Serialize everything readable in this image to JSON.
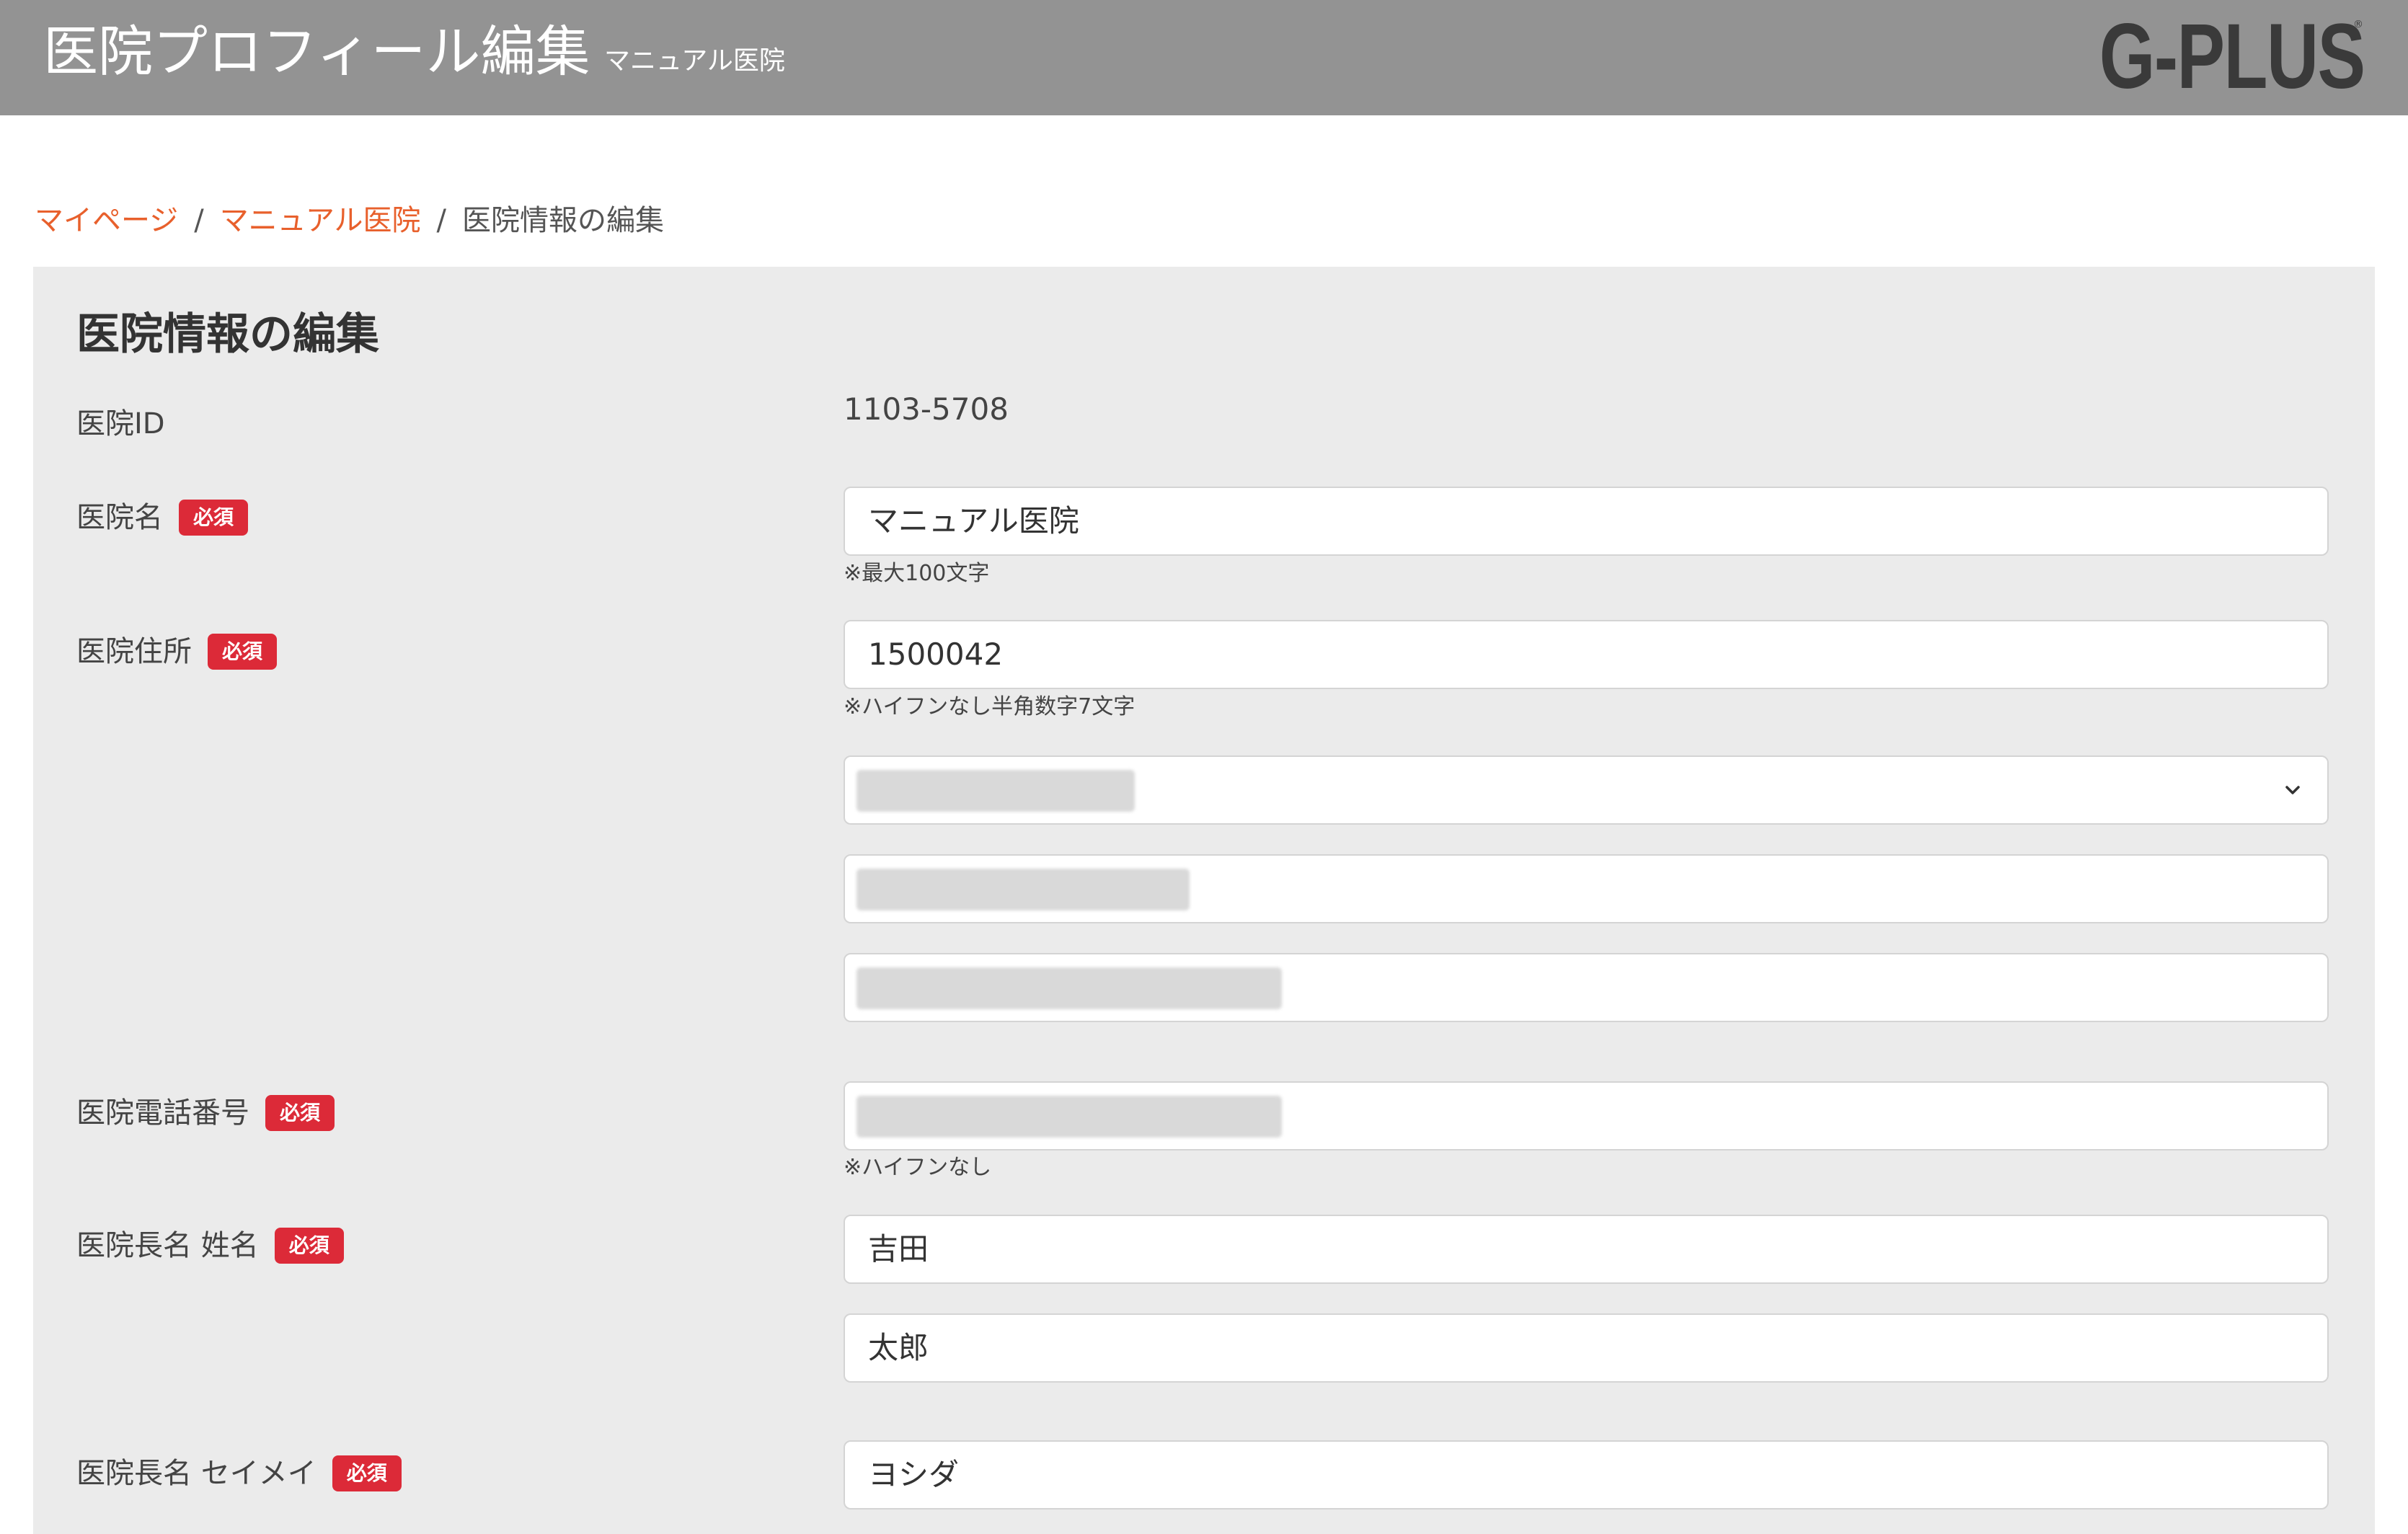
{
  "header": {
    "title": "医院プロフィール編集",
    "subtitle": "マニュアル医院",
    "logo": "G-PLUS",
    "logo_mark": "®"
  },
  "breadcrumb": {
    "items": [
      "マイページ",
      "マニュアル医院",
      "医院情報の編集"
    ],
    "separator": "/"
  },
  "form": {
    "title": "医院情報の編集",
    "required_badge": "必須",
    "clinic_id": {
      "label": "医院ID",
      "value": "1103-5708"
    },
    "clinic_name": {
      "label": "医院名",
      "value": "マニュアル医院",
      "hint": "※最大100文字"
    },
    "address": {
      "label": "医院住所",
      "postal_code": "1500042",
      "hint": "※ハイフンなし半角数字7文字",
      "prefecture_icon": "chevron-down-icon"
    },
    "phone": {
      "label": "医院電話番号",
      "hint": "※ハイフンなし"
    },
    "director_name": {
      "label": "医院長名 姓名",
      "last_name": "吉田",
      "first_name": "太郎"
    },
    "director_kana": {
      "label": "医院長名 セイメイ",
      "last_name": "ヨシダ"
    }
  },
  "colors": {
    "header_bg": "#939393",
    "panel_bg": "#ebebeb",
    "link": "#e8602c",
    "badge": "#dc2a38"
  }
}
